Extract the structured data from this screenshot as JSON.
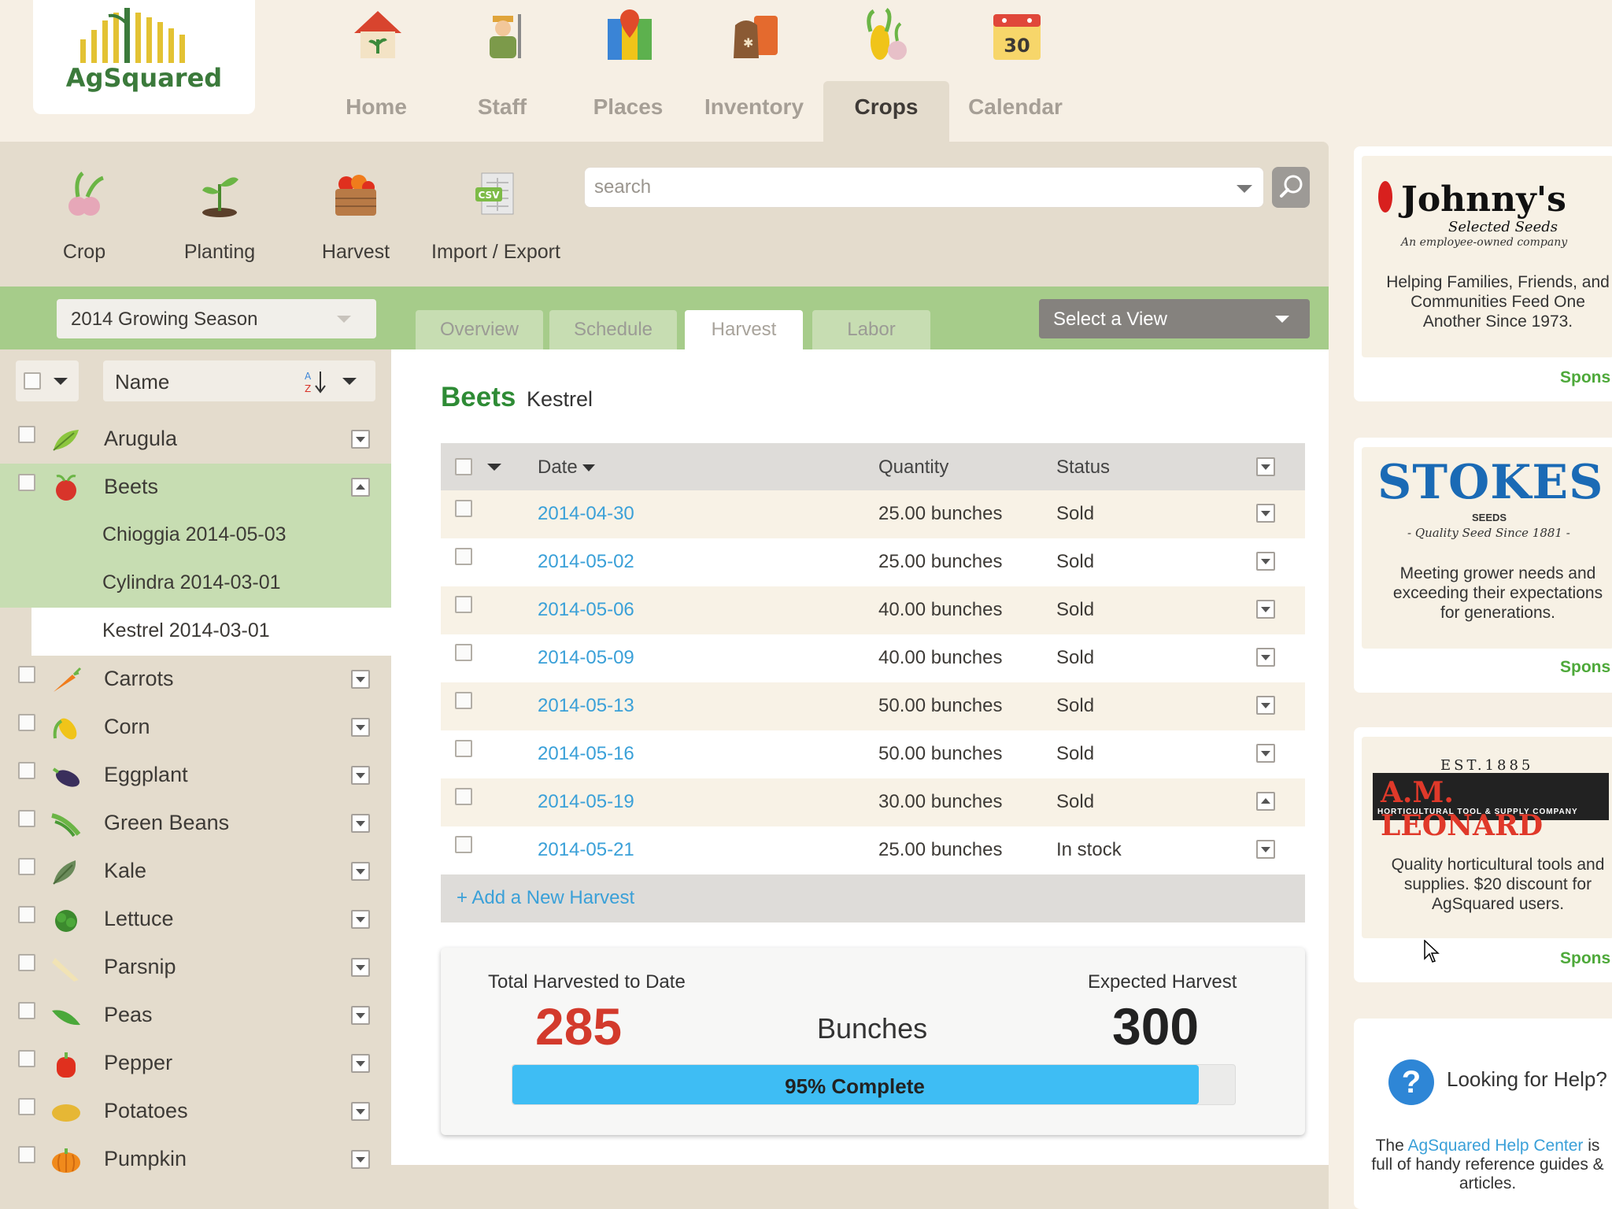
{
  "brand": {
    "name": "AgSquared"
  },
  "nav": [
    {
      "label": "Home",
      "icon": "home-icon"
    },
    {
      "label": "Staff",
      "icon": "staff-icon"
    },
    {
      "label": "Places",
      "icon": "places-icon"
    },
    {
      "label": "Inventory",
      "icon": "inventory-icon"
    },
    {
      "label": "Crops",
      "icon": "crops-icon",
      "active": true
    },
    {
      "label": "Calendar",
      "icon": "calendar-icon",
      "day": "30"
    }
  ],
  "toolbar": [
    {
      "label": "Crop",
      "icon": "crop-icon"
    },
    {
      "label": "Planting",
      "icon": "planting-icon"
    },
    {
      "label": "Harvest",
      "icon": "harvest-icon"
    },
    {
      "label": "Import / Export",
      "icon": "csv-icon"
    }
  ],
  "search": {
    "placeholder": "search",
    "value": ""
  },
  "season": "2014 Growing Season",
  "tabs": [
    "Overview",
    "Schedule",
    "Harvest",
    "Labor"
  ],
  "active_tab": "Harvest",
  "view_select": "Select a View",
  "sidebar": {
    "sort_label": "Name",
    "sort_icon": "sort-az-icon",
    "crops": [
      {
        "name": "Arugula",
        "color": "#8cc63f"
      },
      {
        "name": "Beets",
        "color": "#d8342a",
        "expanded": true,
        "plantings": [
          "Chioggia 2014-05-03",
          "Cylindra 2014-03-01",
          "Kestrel 2014-03-01"
        ],
        "active_planting": "Kestrel 2014-03-01"
      },
      {
        "name": "Carrots",
        "color": "#f07c1c"
      },
      {
        "name": "Corn",
        "color": "#f0c419"
      },
      {
        "name": "Eggplant",
        "color": "#3a2f5c"
      },
      {
        "name": "Green Beans",
        "color": "#6bb545"
      },
      {
        "name": "Kale",
        "color": "#6a8a5a"
      },
      {
        "name": "Lettuce",
        "color": "#3c8a2e"
      },
      {
        "name": "Parsnip",
        "color": "#f1e3b5"
      },
      {
        "name": "Peas",
        "color": "#4aa83a"
      },
      {
        "name": "Pepper",
        "color": "#e0301e"
      },
      {
        "name": "Potatoes",
        "color": "#e6b735"
      },
      {
        "name": "Pumpkin",
        "color": "#f08a1c"
      }
    ]
  },
  "detail": {
    "crop": "Beets",
    "variety": "Kestrel",
    "columns": {
      "date": "Date",
      "quantity": "Quantity",
      "status": "Status"
    },
    "harvests": [
      {
        "date": "2014-04-30",
        "quantity": "25.00 bunches",
        "status": "Sold"
      },
      {
        "date": "2014-05-02",
        "quantity": "25.00 bunches",
        "status": "Sold"
      },
      {
        "date": "2014-05-06",
        "quantity": "40.00 bunches",
        "status": "Sold"
      },
      {
        "date": "2014-05-09",
        "quantity": "40.00 bunches",
        "status": "Sold"
      },
      {
        "date": "2014-05-13",
        "quantity": "50.00 bunches",
        "status": "Sold"
      },
      {
        "date": "2014-05-16",
        "quantity": "50.00 bunches",
        "status": "Sold"
      },
      {
        "date": "2014-05-19",
        "quantity": "30.00 bunches",
        "status": "Sold",
        "menu_open": true
      },
      {
        "date": "2014-05-21",
        "quantity": "25.00 bunches",
        "status": "In stock"
      }
    ],
    "add_link": "+ Add a New Harvest",
    "summary": {
      "total_label": "Total Harvested to Date",
      "total": "285",
      "unit": "Bunches",
      "expected_label": "Expected Harvest",
      "expected": "300",
      "progress_text": "95% Complete",
      "progress": 0.95,
      "total_color": "#d33a2c"
    }
  },
  "ads": [
    {
      "brand": "Johnny's",
      "brand_sub": "Selected Seeds",
      "tagline": "An employee-owned company",
      "desc": "Helping Families, Friends, and Communities Feed One Another Since 1973.",
      "sponsor": "Spons"
    },
    {
      "brand": "STOKES",
      "brand_sub": "SEEDS",
      "tagline": "- Quality Seed Since 1881 -",
      "desc": "Meeting grower needs and exceeding their expectations for generations.",
      "sponsor": "Spons"
    },
    {
      "brand": "A.M. LEONARD",
      "brand_est": "EST.1885",
      "tagline": "HORTICULTURAL TOOL & SUPPLY COMPANY",
      "desc": "Quality horticultural tools and supplies. $20 discount for AgSquared users.",
      "sponsor": "Spons"
    }
  ],
  "help": {
    "title": "Looking for Help?",
    "text_before": "The ",
    "link": "AgSquared Help Center",
    "text_after": " is full of handy reference guides & articles."
  }
}
